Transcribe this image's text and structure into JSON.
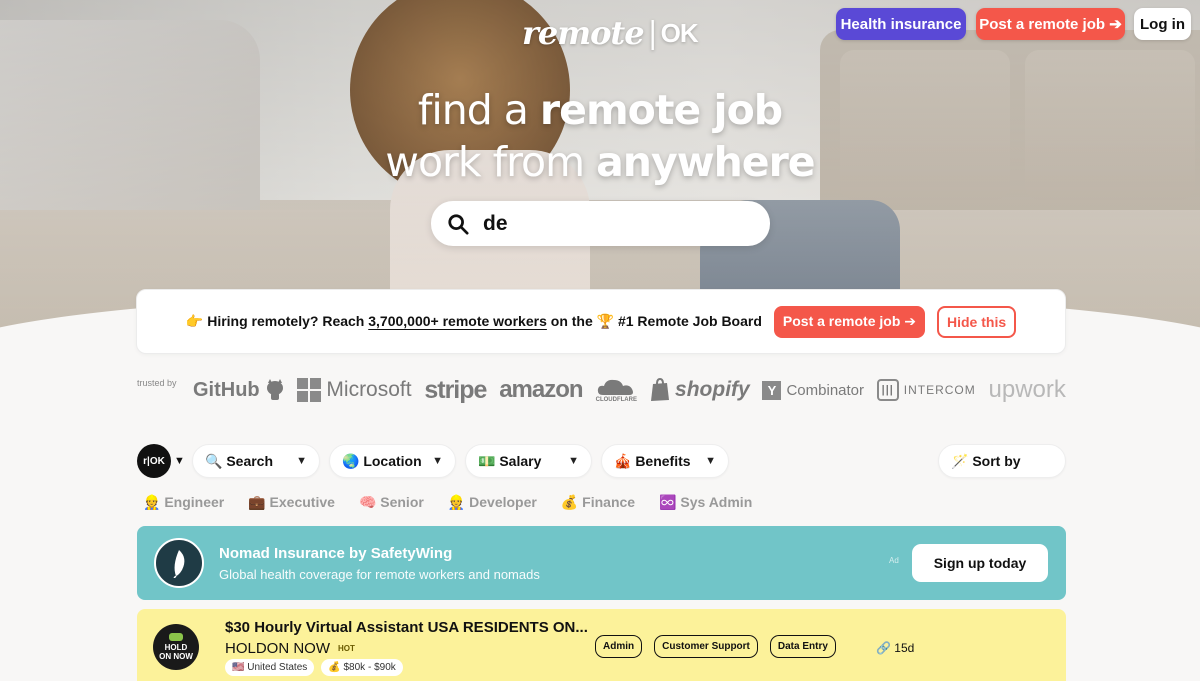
{
  "header": {
    "logo_main": "remote",
    "logo_sep": "|",
    "logo_ok": "OK",
    "health_label": "Health insurance",
    "post_label": "Post a remote job ➔",
    "login_label": "Log in"
  },
  "hero": {
    "line1_pre": "find a ",
    "line1_bold": "remote job",
    "line2_pre": "work from ",
    "line2_bold": "anywhere"
  },
  "search": {
    "value": "de",
    "placeholder": ""
  },
  "banner": {
    "emoji": "👉",
    "pre": "Hiring remotely? Reach ",
    "link": "3,700,000+ remote workers",
    "post": " on the 🏆 #1 Remote Job Board",
    "post_button": "Post a remote job ➔",
    "hide_button": "Hide this"
  },
  "trusted": {
    "label": "trusted by",
    "github": "GitHub",
    "microsoft": "Microsoft",
    "stripe": "stripe",
    "amazon": "amazon",
    "cloudflare": "CLOUDFLARE",
    "shopify": "shopify",
    "yc_letter": "Y",
    "yc": "Combinator",
    "intercom": "INTERCOM",
    "upwork": "upwork"
  },
  "filters": {
    "logo": "r|OK",
    "search": "🔍 Search",
    "location": "🌏 Location",
    "salary": "💵 Salary",
    "benefits": "🎪 Benefits",
    "sort": "🪄 Sort by"
  },
  "tags": [
    "👷 Engineer",
    "💼 Executive",
    "🧠 Senior",
    "👷 Developer",
    "💰 Finance",
    "♾️ Sys Admin"
  ],
  "ad": {
    "title": "Nomad Insurance by SafetyWing",
    "subtitle": "Global health coverage for remote workers and nomads",
    "small": "Ad",
    "cta": "Sign up today"
  },
  "job": {
    "title": "$30 Hourly Virtual Assistant USA RESIDENTS ON...",
    "company": "HOLDON NOW",
    "hot": "HOT",
    "logo_line1": "HOLD",
    "logo_line2": "ON NOW",
    "location": "🇺🇸 United States",
    "salary": "💰 $80k - $90k",
    "tags": [
      "Admin",
      "Customer Support",
      "Data Entry"
    ],
    "age": "🔗 15d"
  },
  "colors": {
    "accent_red": "#f4574a",
    "accent_purple": "#5a49d6",
    "ad_teal": "#71c5c8",
    "job_yellow": "#fcf29a"
  }
}
